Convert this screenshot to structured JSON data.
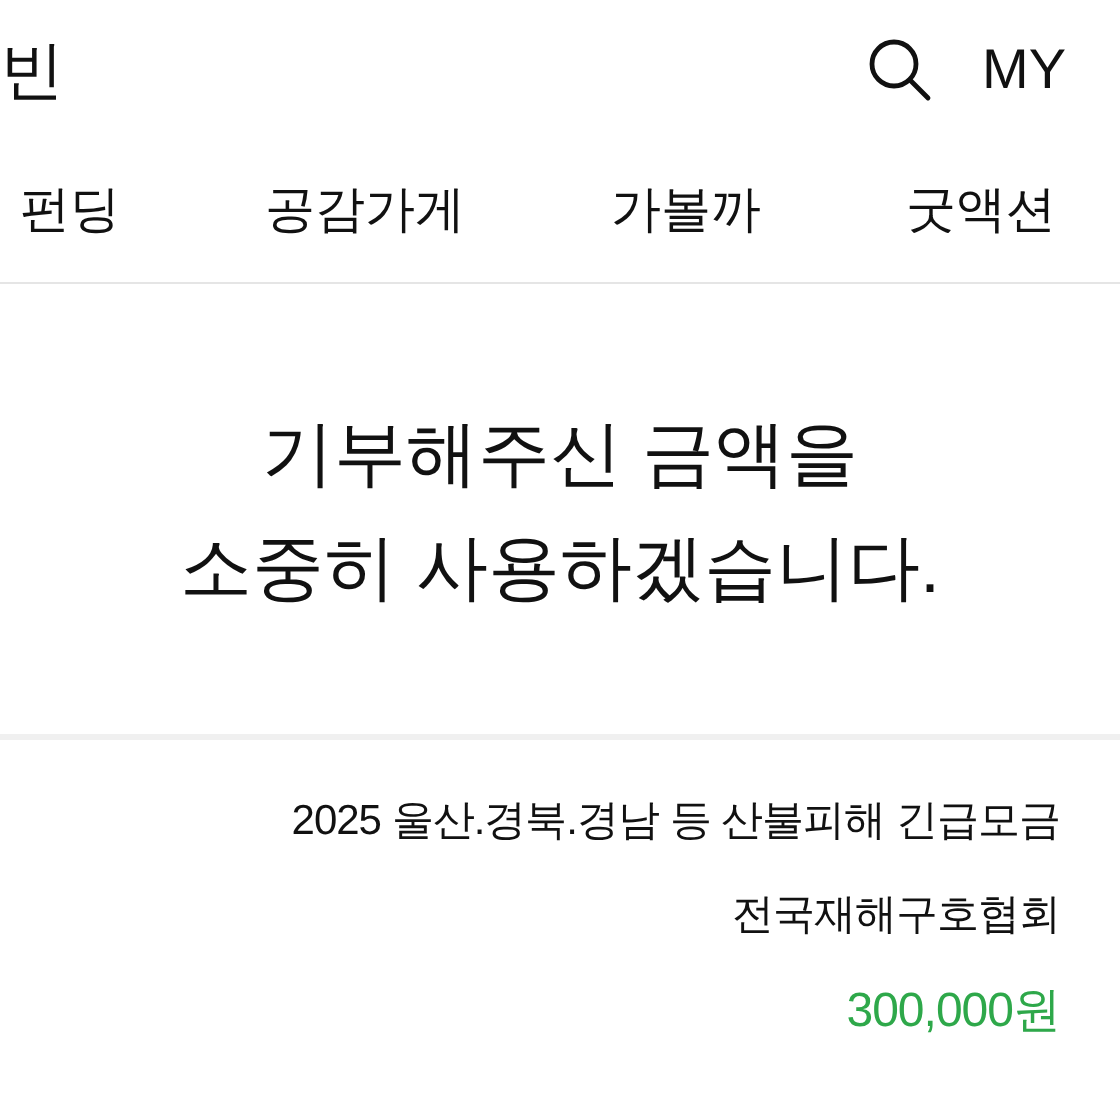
{
  "header": {
    "logo": "빈",
    "my": "MY"
  },
  "tabs": [
    {
      "label": "펀딩"
    },
    {
      "label": "공감가게"
    },
    {
      "label": "가볼까"
    },
    {
      "label": "굿액션"
    }
  ],
  "message": {
    "lines": [
      "기부해주신 금액을",
      "소중히 사용하겠습니다."
    ]
  },
  "donation": {
    "campaign": "2025 울산.경북.경남 등 산불피해 긴급모금",
    "organization": "전국재해구호협회",
    "amount": "300,000원"
  }
}
